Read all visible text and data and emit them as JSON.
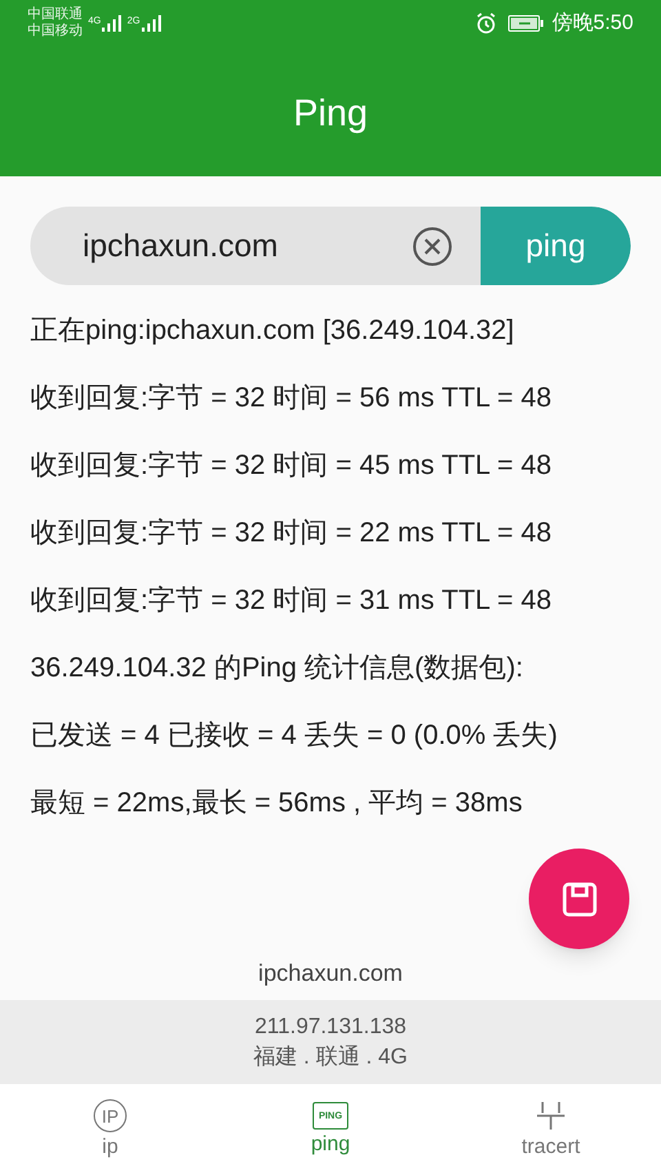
{
  "status_bar": {
    "carriers": [
      "中国联通",
      "中国移动"
    ],
    "networks": [
      "4G",
      "2G"
    ],
    "time": "傍晚5:50"
  },
  "header": {
    "title": "Ping"
  },
  "search": {
    "value": "ipchaxun.com",
    "button": "ping"
  },
  "results": [
    "正在ping:ipchaxun.com [36.249.104.32]",
    "收到回复:字节 = 32 时间 = 56 ms TTL = 48",
    "收到回复:字节 = 32 时间 = 45 ms TTL = 48",
    "收到回复:字节 = 32 时间 = 22 ms TTL = 48",
    "收到回复:字节 = 32 时间 = 31 ms TTL = 48",
    "36.249.104.32 的Ping 统计信息(数据包):",
    "已发送 = 4 已接收 = 4 丢失 = 0 (0.0% 丢失)",
    "最短 = 22ms,最长 = 56ms , 平均 = 38ms"
  ],
  "footer": {
    "site": "ipchaxun.com",
    "ip": "211.97.131.138",
    "location": "福建 . 联通 . 4G"
  },
  "tabs": [
    {
      "kind": "ip",
      "label": "ip",
      "icon_text": "IP",
      "selected": false
    },
    {
      "kind": "ping",
      "label": "ping",
      "icon_text": "PING",
      "selected": true
    },
    {
      "kind": "tracert",
      "label": "tracert",
      "selected": false
    }
  ]
}
